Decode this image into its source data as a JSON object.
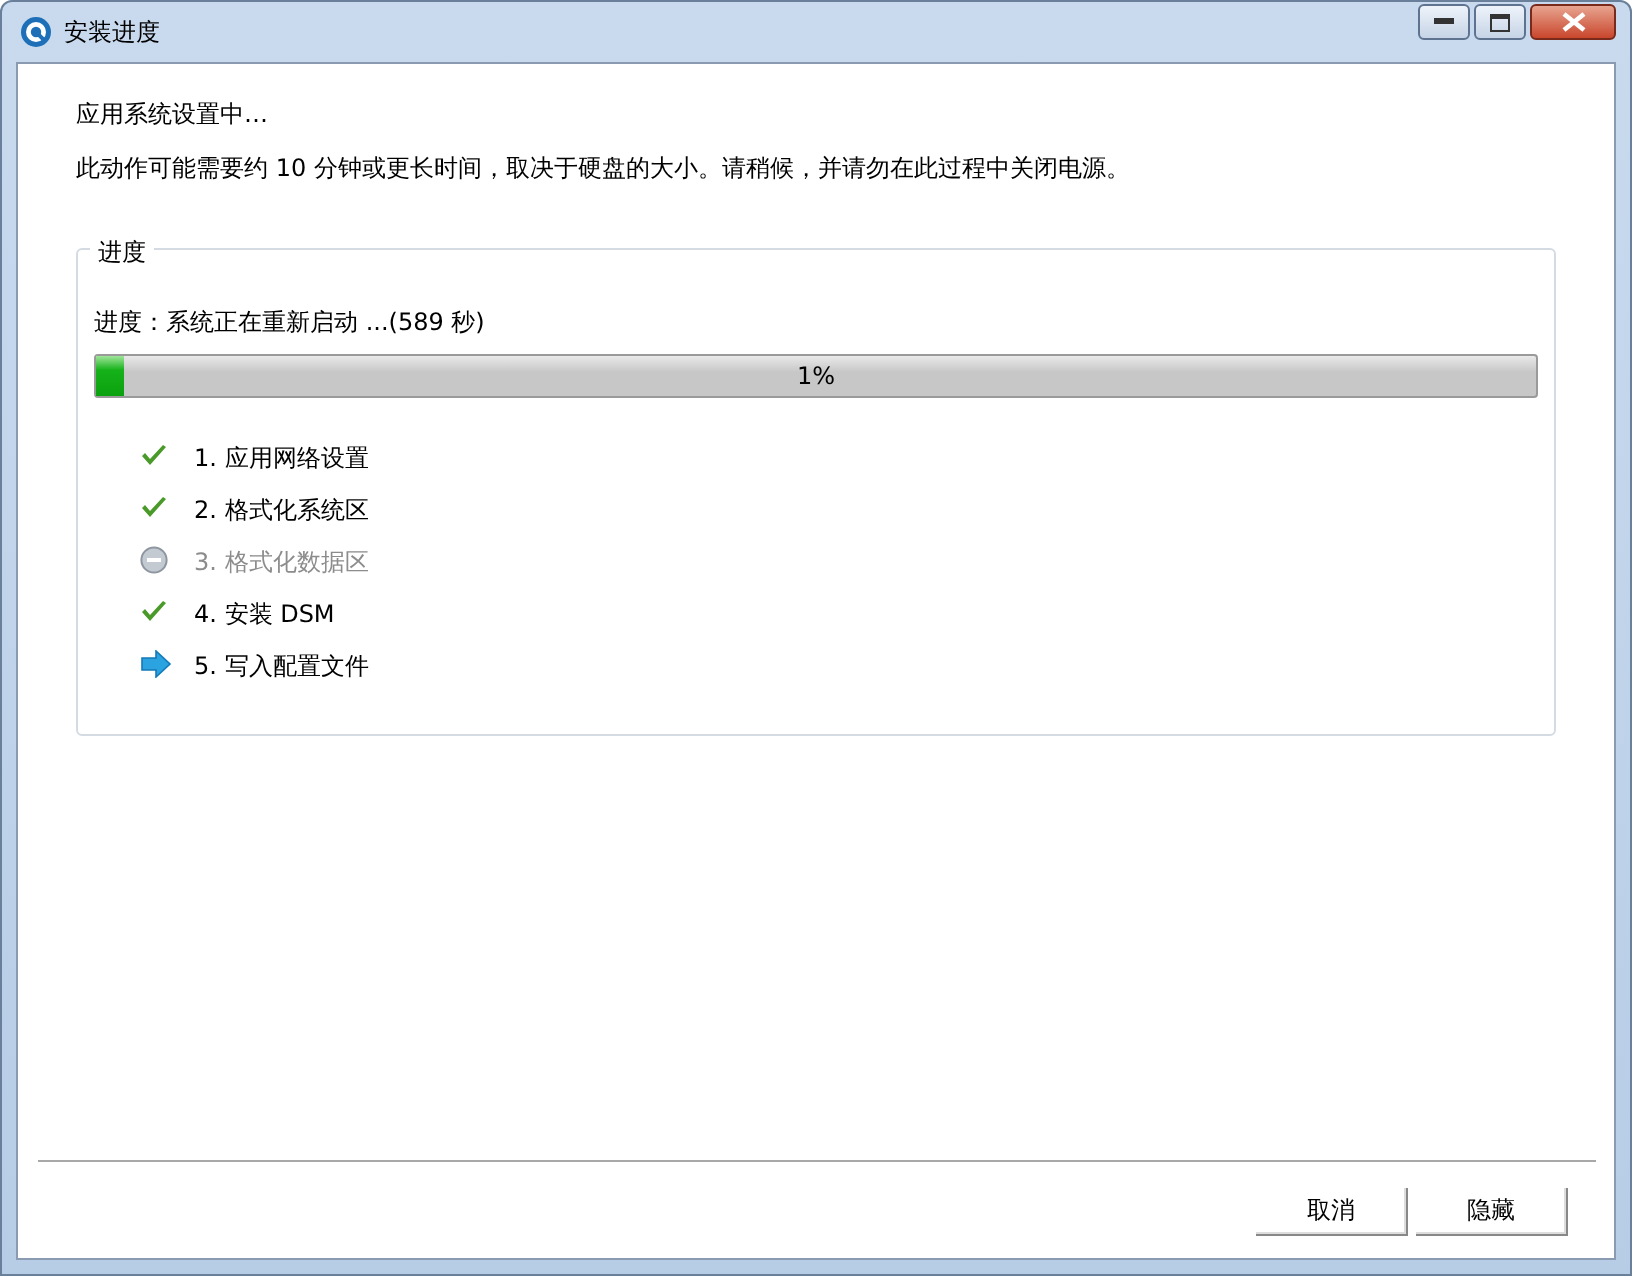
{
  "window": {
    "title": "安装进度"
  },
  "messages": [
    "应用系统设置中…",
    "此动作可能需要约 10 分钟或更长时间，取决于硬盘的大小。请稍候，并请勿在此过程中关闭电源。"
  ],
  "progress_group": {
    "title": "进度",
    "status": "进度：系统正在重新启动 ...(589 秒)",
    "level": 0.01,
    "reading": "1%",
    "steps": [
      {
        "label": "1. 应用网络设置",
        "kind": "done"
      },
      {
        "label": "2. 格式化系统区",
        "kind": "done"
      },
      {
        "label": "3. 格式化数据区",
        "kind": "skipped"
      },
      {
        "label": "4. 安装 DSM",
        "kind": "done"
      },
      {
        "label": "5. 写入配置文件",
        "kind": "current"
      }
    ]
  },
  "buttons": [
    "取消",
    "隐藏"
  ]
}
